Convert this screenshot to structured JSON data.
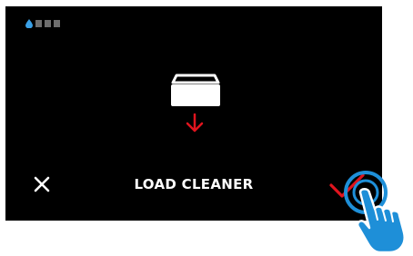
{
  "screen": {
    "title": "LOAD CLEANER"
  },
  "icons": {
    "water_drop": "water-drop-icon",
    "cleaner": "cleaner-cartridge-icon",
    "arrow": "arrow-down-icon",
    "close": "close-icon",
    "confirm": "checkmark-icon",
    "pointer": "tapping-hand-icon"
  },
  "level": {
    "filled": 0,
    "total": 3
  },
  "colors": {
    "screen_bg": "#000000",
    "text": "#ffffff",
    "accent_red": "#e0141e",
    "drop_blue": "#3aa0e6",
    "hand_blue": "#1e8fd8",
    "level_gray": "#6e6e6e"
  }
}
